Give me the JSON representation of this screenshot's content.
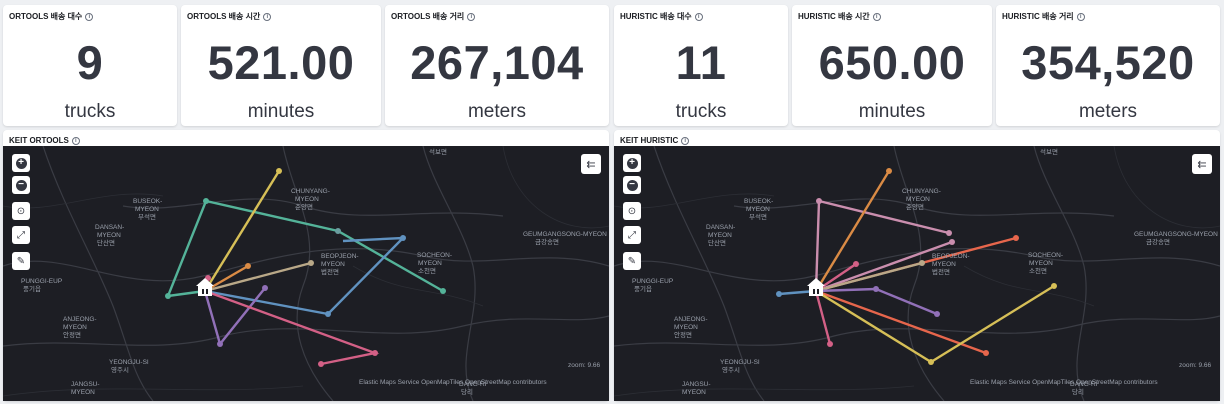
{
  "metrics": [
    {
      "title": "ORTOOLS 배송 대수",
      "value": "9",
      "unit": "trucks"
    },
    {
      "title": "ORTOOLS 배송 시간",
      "value": "521.00",
      "unit": "minutes"
    },
    {
      "title": "ORTOOLS 배송 거리",
      "value": "267,104",
      "unit": "meters"
    },
    {
      "title": "HURISTIC 배송 대수",
      "value": "11",
      "unit": "trucks"
    },
    {
      "title": "HURISTIC 배송 시간",
      "value": "650.00",
      "unit": "minutes"
    },
    {
      "title": "HURISTIC 배송 거리",
      "value": "354,520",
      "unit": "meters"
    }
  ],
  "maps": [
    {
      "title": "KEIT ORTOOLS"
    },
    {
      "title": "KEIT HURISTIC"
    }
  ],
  "map_controls": {
    "zoom_in": "+",
    "zoom_out": "−",
    "fit": "⊙",
    "fullscreen": "⤢",
    "tools": "✎",
    "legend": "⇇"
  },
  "places": {
    "sukbo": "석보면",
    "chunyang": "CHUNYANG-\nMYEON",
    "chunyang_kr": "춘양면",
    "buseok": "BUSEOK-\nMYEON",
    "buseok_kr": "부석면",
    "dansan": "DANSAN-\nMYEON",
    "dansan_kr": "단산면",
    "beopjeon": "BEOPJEON-\nMYEON",
    "beopjeon_kr": "법전면",
    "socheon": "SOCHEON-\nMYEON",
    "socheon_kr": "소천면",
    "geumgang": "GEUMGANGSONG-MYEON",
    "geumgang_kr": "금강송면",
    "punggi": "PUNGGI-EUP",
    "punggi_kr": "풍기읍",
    "anjeong": "ANJEONG-\nMYEON",
    "anjeong_kr": "안정면",
    "yeongju": "YEONGJU-SI",
    "yeongju_kr": "영주시",
    "jangsu": "JANGSU-\nMYEON",
    "dangri": "DANG-RI",
    "dangri_kr": "당리"
  },
  "attribution": "Elastic Maps Service  OpenMapTiles  OpenStreetMap contributors",
  "zoom_text": "zoom: 9.66",
  "colors": {
    "green": "#54b399",
    "teal": "#6092c0",
    "blue": "#6092c0",
    "gold": "#d6bf57",
    "pink": "#d36086",
    "purple": "#9170b8",
    "orange": "#da8b45",
    "tan": "#aa6556",
    "lavender": "#ca8eae",
    "redorange": "#e7664c",
    "sage": "#b9a888"
  }
}
